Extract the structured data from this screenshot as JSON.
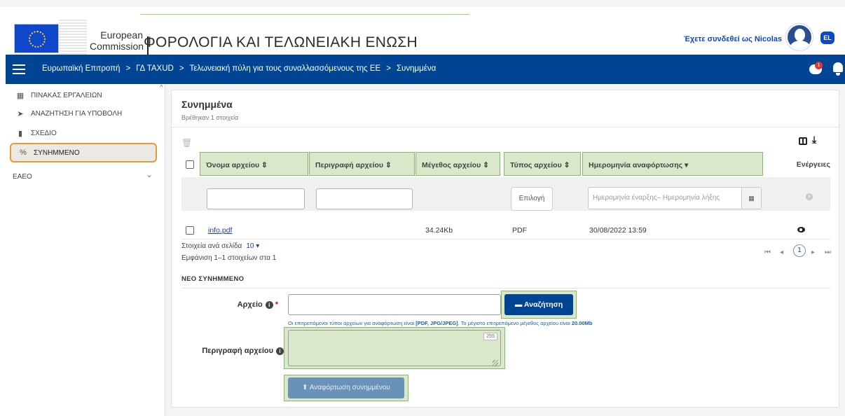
{
  "header": {
    "logo_line1": "European",
    "logo_line2": "Commission",
    "title": "ΦΟΡΟΛΟΓΙΑ ΚΑΙ ΤΕΛΩΝΕΙΑΚΗ ΕΝΩΣΗ",
    "user_text": "Έχετε συνδεθεί ως Nicolas",
    "language": "EL",
    "notification_count": "1"
  },
  "breadcrumb": [
    "Ευρωπαϊκή Επιτροπή",
    "ΓΔ TAXUD",
    "Τελωνειακή πύλη για τους συναλλασσόμενους της ΕΕ",
    "Συνημμένα"
  ],
  "breadcrumb_sep": ">",
  "sidebar": {
    "items": [
      {
        "label": "ΠΙΝΑΚΑΣ ΕΡΓΑΛΕΙΩΝ",
        "icon": "dashboard-icon"
      },
      {
        "label": "ΑΝΑΖΗΤΗΣΗ ΓΙΑ ΥΠΟΒΟΛΗ",
        "icon": "send-icon"
      },
      {
        "label": "ΣΧΕΔΙΟ",
        "icon": "draft-icon"
      },
      {
        "label": "ΣΥΝΗΜΜΕΝΟ",
        "icon": "attachment-icon",
        "active": true
      },
      {
        "label": "ΕΑΕΟ",
        "icon": "chevron-down-icon"
      }
    ]
  },
  "main": {
    "title": "Συνημμένα",
    "subtitle": "Βρέθηκαν 1 στοιχεία",
    "columns": [
      "Όνομα αρχείου ⇕",
      "Περιγραφή αρχείου ⇕",
      "Μέγεθος αρχείου ⇕",
      "Τύπος αρχείου ⇕",
      "Ημερομηνία αναφόρτωσης ▾",
      "Ενέργειες"
    ],
    "filters": {
      "type_select": "Επιλογή",
      "date_range_placeholder": "Ημερομηνία έναρξης– Ημερομηνία λήξης"
    },
    "rows": [
      {
        "name": "info.pdf",
        "description": "",
        "size": "34.24Kb",
        "type": "PDF",
        "uploaded": "30/08/2022 13:59"
      }
    ],
    "per_page_label": "Στοιχεία ανά σελίδα",
    "per_page_value": "10 ▾",
    "showing": "Εμφάνιση 1–1 στοιχείων στα 1",
    "current_page": "1"
  },
  "new_attachment": {
    "section_label": "ΝΕΟ ΣΥΝΗΜΜΕΝΟ",
    "file_label": "Αρχείο",
    "browse_button": "Αναζήτηση",
    "hint_prefix": "Οι επιτρεπόμενοι τύποι αρχείων για αναφόρτωση είναι ",
    "hint_types": "[PDF, JPG/JPEG]",
    "hint_middle": ". Το μέγιστο επιτρεπόμενο μέγεθος αρχείου είναι ",
    "hint_size": "20.00Mb",
    "description_label": "Περιγραφή αρχείου",
    "char_counter": "255",
    "upload_button": "Αναφόρτωση συνημμένου"
  },
  "colors": {
    "brand_blue": "#004494",
    "highlight_green": "#d8e8c8",
    "highlight_border": "#86b86a",
    "active_outline": "#e59a33"
  }
}
